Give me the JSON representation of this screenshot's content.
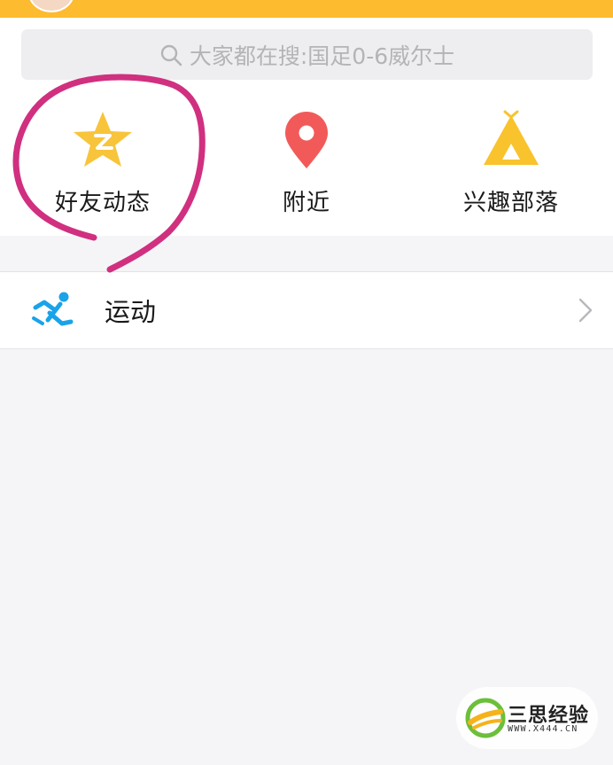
{
  "search": {
    "placeholder": "大家都在搜:国足0-6威尔士"
  },
  "quick_actions": [
    {
      "label": "好友动态",
      "icon": "qzone-star-icon"
    },
    {
      "label": "附近",
      "icon": "location-pin-icon"
    },
    {
      "label": "兴趣部落",
      "icon": "tent-icon"
    }
  ],
  "list": [
    {
      "label": "运动",
      "icon": "running-icon"
    }
  ],
  "watermark": {
    "title": "三思经验",
    "url": "WWW.X444.CN"
  },
  "colors": {
    "top_bar": "#fdbb2f",
    "annotation_stroke": "#d0307f"
  }
}
